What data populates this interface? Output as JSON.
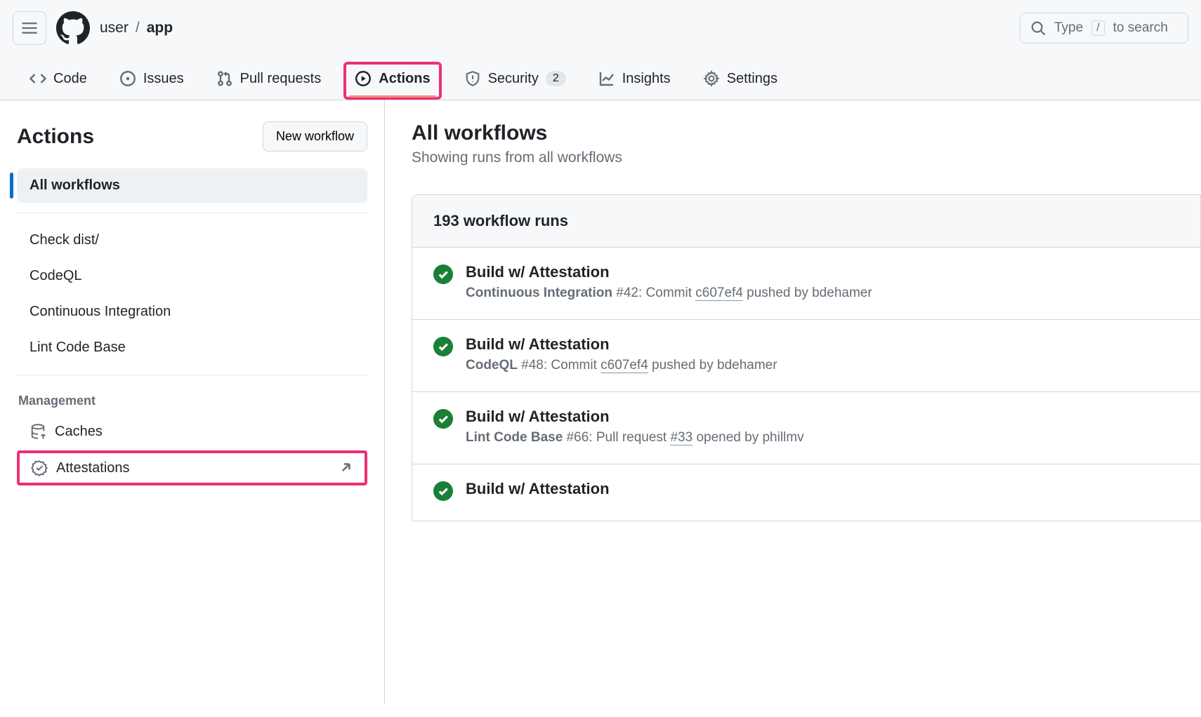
{
  "breadcrumb": {
    "owner": "user",
    "sep": "/",
    "repo": "app"
  },
  "search": {
    "placeholder_pre": "Type",
    "key": "/",
    "placeholder_post": "to search"
  },
  "tabs": {
    "code": "Code",
    "issues": "Issues",
    "pulls": "Pull requests",
    "actions": "Actions",
    "security": "Security",
    "security_badge": "2",
    "insights": "Insights",
    "settings": "Settings"
  },
  "sidebar": {
    "title": "Actions",
    "new_workflow": "New workflow",
    "all_workflows": "All workflows",
    "workflows": [
      "Check dist/",
      "CodeQL",
      "Continuous Integration",
      "Lint Code Base"
    ],
    "management_label": "Management",
    "caches": "Caches",
    "attestations": "Attestations"
  },
  "content": {
    "title": "All workflows",
    "subtitle": "Showing runs from all workflows",
    "run_count_label": "193 workflow runs",
    "runs": [
      {
        "title": "Build w/ Attestation",
        "workflow": "Continuous Integration",
        "run_no": "#42",
        "middle": ": Commit ",
        "link": "c607ef4",
        "suffix": " pushed by bdehamer"
      },
      {
        "title": "Build w/ Attestation",
        "workflow": "CodeQL",
        "run_no": "#48",
        "middle": ": Commit ",
        "link": "c607ef4",
        "suffix": " pushed by bdehamer"
      },
      {
        "title": "Build w/ Attestation",
        "workflow": "Lint Code Base",
        "run_no": "#66",
        "middle": ": Pull request ",
        "link": "#33",
        "suffix": " opened by phillmv"
      },
      {
        "title": "Build w/ Attestation",
        "workflow": "",
        "run_no": "",
        "middle": "",
        "link": "",
        "suffix": ""
      }
    ]
  }
}
